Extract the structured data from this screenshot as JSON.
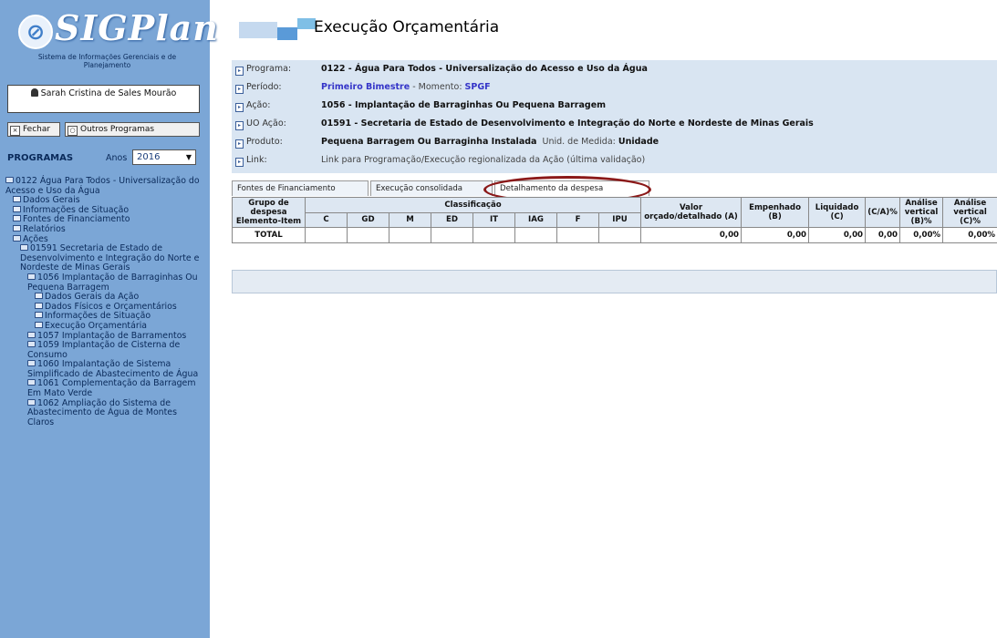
{
  "sidebar": {
    "logo_text": "SIGPlan",
    "subtitle": "Sistema de Informações Gerenciais e de Planejamento",
    "user_name": "Sarah Cristina de Sales Mourão",
    "close_label": "Fechar",
    "other_programs_label": "Outros Programas",
    "programs_heading": "PROGRAMAS",
    "years_label": "Anos",
    "year_value": "2016",
    "tree": [
      {
        "level": 0,
        "icon": "folder",
        "label": "0122 Água Para Todos - Universalização do Acesso e Uso da Água"
      },
      {
        "level": 1,
        "icon": "doc",
        "label": "Dados Gerais"
      },
      {
        "level": 1,
        "icon": "doc",
        "label": "Informações de Situação"
      },
      {
        "level": 1,
        "icon": "doc",
        "label": "Fontes de Financiamento"
      },
      {
        "level": 1,
        "icon": "doc",
        "label": "Relatórios"
      },
      {
        "level": 1,
        "icon": "folder",
        "label": "Ações"
      },
      {
        "level": 2,
        "icon": "folder",
        "label": "01591 Secretaria de Estado de Desenvolvimento e Integração do Norte e Nordeste de Minas Gerais"
      },
      {
        "level": 3,
        "icon": "folder",
        "label": "1056 Implantação de Barraginhas Ou Pequena Barragem"
      },
      {
        "level": 4,
        "icon": "doc",
        "label": "Dados Gerais da Ação"
      },
      {
        "level": 4,
        "icon": "doc",
        "label": "Dados Físicos e Orçamentários"
      },
      {
        "level": 4,
        "icon": "doc",
        "label": "Informações de Situação"
      },
      {
        "level": 4,
        "icon": "doc",
        "label": "Execução Orçamentária"
      },
      {
        "level": 3,
        "icon": "folder",
        "label": "1057 Implantação de Barramentos"
      },
      {
        "level": 3,
        "icon": "folder",
        "label": "1059 Implantação de Cisterna de Consumo"
      },
      {
        "level": 3,
        "icon": "folder",
        "label": "1060 Impalantação de Sistema Simplificado de Abastecimento de Água"
      },
      {
        "level": 3,
        "icon": "folder",
        "label": "1061 Complementação da Barragem Em Mato Verde"
      },
      {
        "level": 3,
        "icon": "folder",
        "label": "1062 Ampliação do Sistema de Abastecimento de Água de Montes Claros"
      }
    ]
  },
  "header": {
    "title": "Execução Orçamentária"
  },
  "info": {
    "programa_label": "Programa:",
    "programa_value": "0122 - Água Para Todos - Universalização do Acesso e Uso da Água",
    "periodo_label": "Período:",
    "periodo_value": "Primeiro Bimestre",
    "momento_label": " - Momento: ",
    "momento_value": "SPGF",
    "acao_label": "Ação:",
    "acao_value": "1056 - Implantação de Barraginhas Ou Pequena Barragem",
    "uo_label": "UO Ação:",
    "uo_value": "01591 - Secretaria de Estado de Desenvolvimento e Integração do Norte e Nordeste de Minas Gerais",
    "produto_label": "Produto:",
    "produto_value": "Pequena Barragem Ou Barraginha Instalada",
    "unid_label": "Unid. de Medida:",
    "unid_value": "Unidade",
    "link_label": "Link:",
    "link_value": "Link para Programação/Execução regionalizada da Ação (última validação)"
  },
  "tabs": [
    {
      "label": "Fontes de Financiamento"
    },
    {
      "label": "Execução consolidada"
    },
    {
      "label": "Detalhamento da despesa"
    }
  ],
  "table": {
    "col_group": "Grupo de despesa Elemento-Item",
    "col_classificacao": "Classificação",
    "sub_cols": [
      "C",
      "GD",
      "M",
      "ED",
      "IT",
      "IAG",
      "F",
      "IPU"
    ],
    "col_valor": "Valor orçado/detalhado (A)",
    "col_empenhado": "Empenhado (B)",
    "col_liquidado": "Liquidado (C)",
    "col_ca": "(C/A)%",
    "col_av_b": "Análise vertical (B)%",
    "col_av_c": "Análise vertical (C)%",
    "total_row": {
      "label": "TOTAL",
      "valor": "0,00",
      "empenhado": "0,00",
      "liquidado": "0,00",
      "ca": "0,00",
      "av_b": "0,00%",
      "av_c": "0,00%"
    }
  },
  "colors": {
    "sidebar": "#7ba6d6",
    "info_panel": "#d9e5f2",
    "highlight_oval": "#8b1919",
    "link_blue": "#3535c8"
  }
}
